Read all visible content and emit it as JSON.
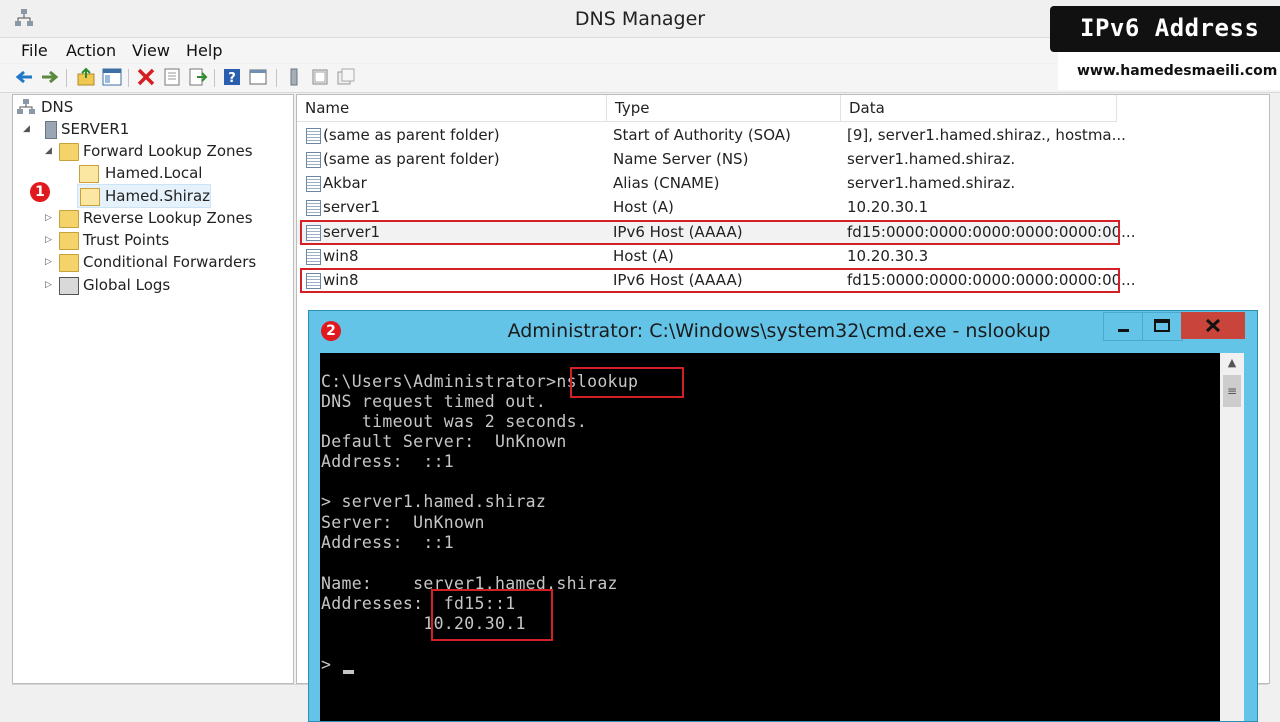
{
  "window": {
    "title": "DNS Manager"
  },
  "menu": [
    "File",
    "Action",
    "View",
    "Help"
  ],
  "tree": {
    "root": "DNS",
    "server": "SERVER1",
    "forward_zones": "Forward Lookup Zones",
    "zone_local": "Hamed.Local",
    "zone_shiraz": "Hamed.Shiraz",
    "reverse_zones": "Reverse Lookup Zones",
    "trust_points": "Trust Points",
    "conditional_forwarders": "Conditional Forwarders",
    "global_logs": "Global Logs"
  },
  "list": {
    "columns": [
      "Name",
      "Type",
      "Data"
    ],
    "records": [
      {
        "name": "(same as parent folder)",
        "type": "Start of Authority (SOA)",
        "data": "[9], server1.hamed.shiraz., hostma..."
      },
      {
        "name": "(same as parent folder)",
        "type": "Name Server (NS)",
        "data": "server1.hamed.shiraz."
      },
      {
        "name": "Akbar",
        "type": "Alias (CNAME)",
        "data": "server1.hamed.shiraz."
      },
      {
        "name": "server1",
        "type": "Host (A)",
        "data": "10.20.30.1"
      },
      {
        "name": "server1",
        "type": "IPv6 Host (AAAA)",
        "data": "fd15:0000:0000:0000:0000:0000:00..."
      },
      {
        "name": "win8",
        "type": "Host (A)",
        "data": "10.20.30.3"
      },
      {
        "name": "win8",
        "type": "IPv6 Host (AAAA)",
        "data": "fd15:0000:0000:0000:0000:0000:00..."
      }
    ]
  },
  "badge": {
    "title": "IPv6 Address",
    "url": "www.hamedesmaeili.com"
  },
  "markers": {
    "one": "1",
    "two": "2"
  },
  "cmd": {
    "title": "Administrator: C:\\Windows\\system32\\cmd.exe - nslookup",
    "close_glyph": "X",
    "lines": [
      "C:\\Users\\Administrator>nslookup",
      "DNS request timed out.",
      "    timeout was 2 seconds.",
      "Default Server:  UnKnown",
      "Address:  ::1",
      "",
      "> server1.hamed.shiraz",
      "Server:  UnKnown",
      "Address:  ::1",
      "",
      "Name:    server1.hamed.shiraz",
      "Addresses:  fd15::1",
      "          10.20.30.1",
      "",
      "> "
    ]
  },
  "colors": {
    "highlight": "#d31f26",
    "cmd_frame": "#64c4e8",
    "close": "#c9443a"
  }
}
